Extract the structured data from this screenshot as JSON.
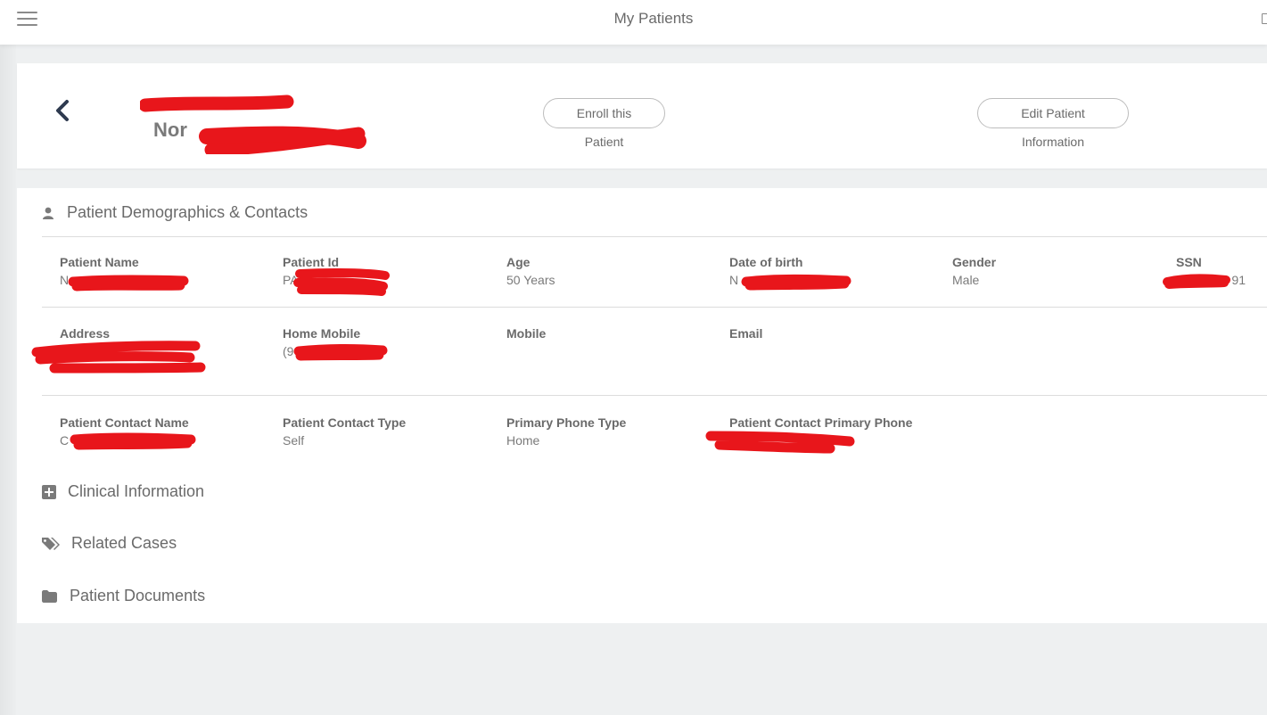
{
  "topbar": {
    "title": "My Patients",
    "menu_icon": "hamburger-menu-icon",
    "right_icon": "document-icon"
  },
  "header": {
    "back_icon": "chevron-left-icon",
    "patient_name_visible": "Nor",
    "enroll_label": "Enroll this Patient",
    "edit_label": "Edit Patient Information"
  },
  "sections": {
    "demographics": {
      "label": "Patient Demographics & Contacts",
      "icon": "user-icon"
    },
    "clinical": {
      "label": "Clinical Information",
      "icon": "plus-square-icon"
    },
    "related": {
      "label": "Related Cases",
      "icon": "tags-icon"
    },
    "documents": {
      "label": "Patient Documents",
      "icon": "folder-icon"
    }
  },
  "fields": {
    "patient_name": {
      "label": "Patient Name",
      "value": "N"
    },
    "patient_id": {
      "label": "Patient Id",
      "value": "PA"
    },
    "age": {
      "label": "Age",
      "value": "50 Years"
    },
    "dob": {
      "label": "Date of birth",
      "value": "N"
    },
    "gender": {
      "label": "Gender",
      "value": "Male"
    },
    "ssn": {
      "label": "SSN",
      "value": "91"
    },
    "address": {
      "label": "Address",
      "value": ""
    },
    "home_mobile": {
      "label": "Home Mobile",
      "value": "(9"
    },
    "mobile": {
      "label": "Mobile",
      "value": ""
    },
    "email": {
      "label": "Email",
      "value": ""
    },
    "contact_name": {
      "label": "Patient Contact Name",
      "value": "C"
    },
    "contact_type": {
      "label": "Patient Contact Type",
      "value": "Self"
    },
    "phone_type": {
      "label": "Primary Phone Type",
      "value": "Home"
    },
    "contact_phone": {
      "label": "Patient Contact Primary Phone",
      "value": ""
    }
  },
  "colors": {
    "redaction": "#e8161b",
    "background": "#eef0f1",
    "text": "#6a6a6a",
    "chevron": "#2e3a4f"
  }
}
